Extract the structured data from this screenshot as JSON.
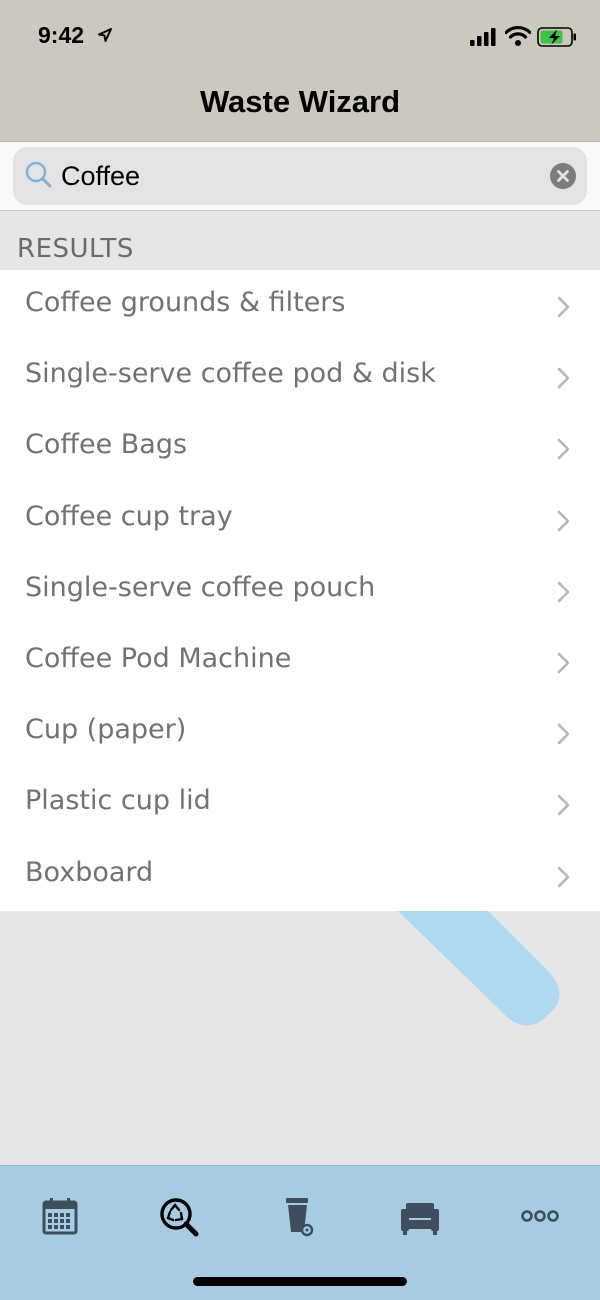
{
  "status_bar": {
    "time": "9:42"
  },
  "nav": {
    "title": "Waste Wizard"
  },
  "search": {
    "value": "Coffee",
    "icon": "search-icon",
    "clear_icon": "clear-icon"
  },
  "results": {
    "header": "RESULTS",
    "items": [
      "Coffee grounds & filters",
      "Single-serve coffee pod & disk",
      "Coffee Bags",
      "Coffee cup tray",
      "Single-serve coffee pouch",
      "Coffee Pod Machine",
      "Cup (paper)",
      "Plastic cup lid",
      "Boxboard"
    ]
  },
  "tab_bar": {
    "tabs": [
      {
        "icon": "calendar-icon",
        "selected": false
      },
      {
        "icon": "recycle-search-icon",
        "selected": true
      },
      {
        "icon": "bin-icon",
        "selected": false
      },
      {
        "icon": "couch-icon",
        "selected": false
      },
      {
        "icon": "more-icon",
        "selected": false
      }
    ]
  },
  "colors": {
    "nav_background": "#ccc8bd",
    "tab_bar_background": "#a7cbe0",
    "accent_stripe": "#afd9f1",
    "list_text": "#727272",
    "icon_dark": "#3f4e5c"
  }
}
